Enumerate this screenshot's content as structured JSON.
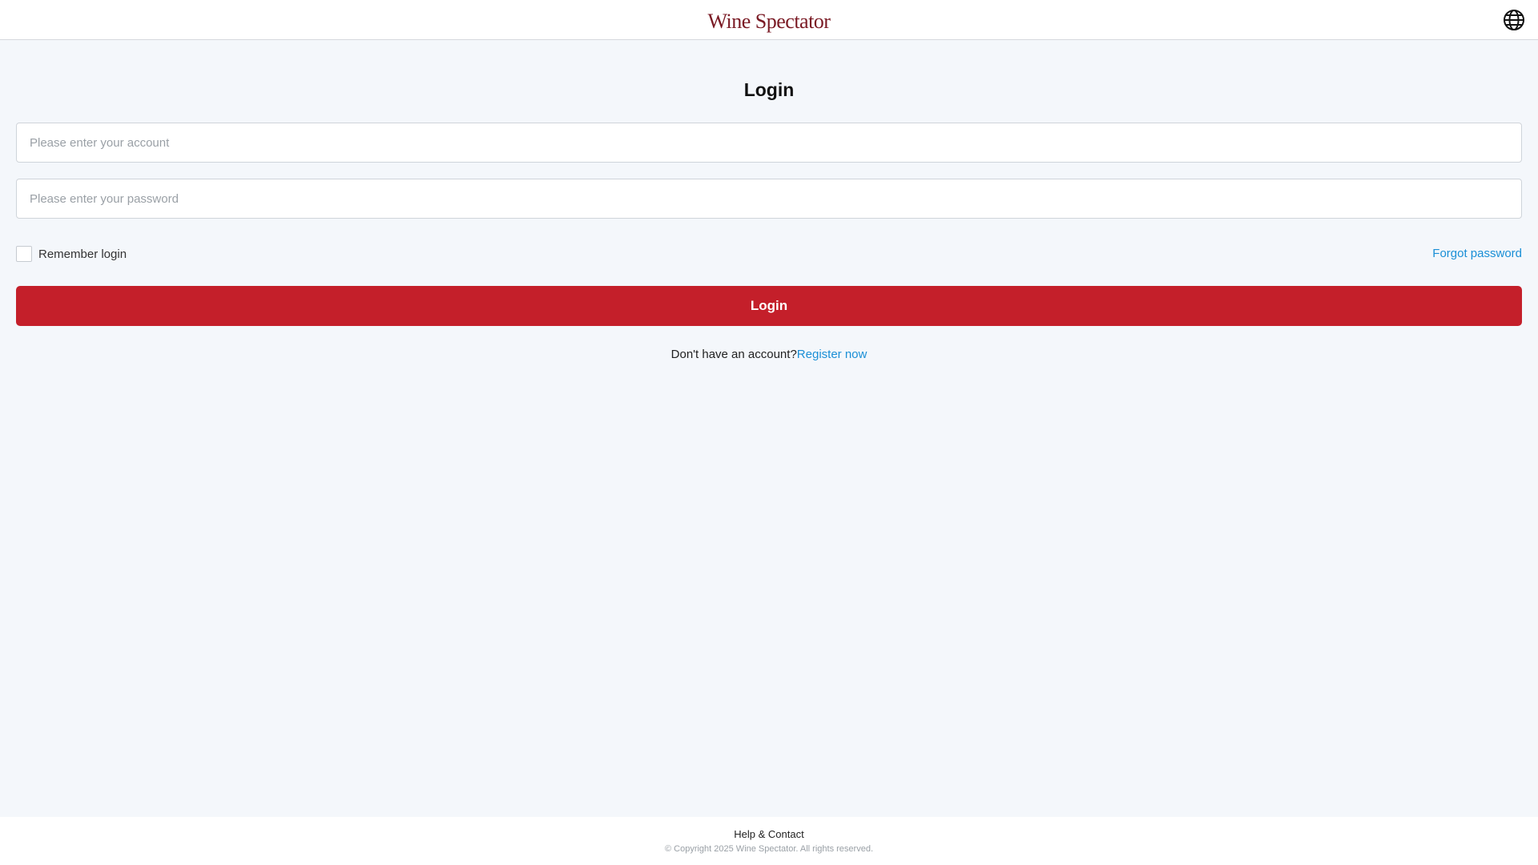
{
  "header": {
    "logo_text": "Wine Spectator",
    "language_icon": "globe-icon"
  },
  "login": {
    "title": "Login",
    "account_placeholder": "Please enter your account",
    "account_value": "",
    "password_placeholder": "Please enter your password",
    "password_value": "",
    "remember_label": "Remember login",
    "remember_checked": false,
    "forgot_label": "Forgot password",
    "submit_label": "Login",
    "register_prompt": "Don't have an account?",
    "register_link": "Register now"
  },
  "footer": {
    "help_label": "Help & Contact",
    "copyright": "© Copyright 2025 Wine Spectator. All rights reserved."
  },
  "colors": {
    "brand": "#7a1a24",
    "primary_button": "#c41f2a",
    "link": "#1a8fd6",
    "page_background": "#f4f7fb"
  }
}
